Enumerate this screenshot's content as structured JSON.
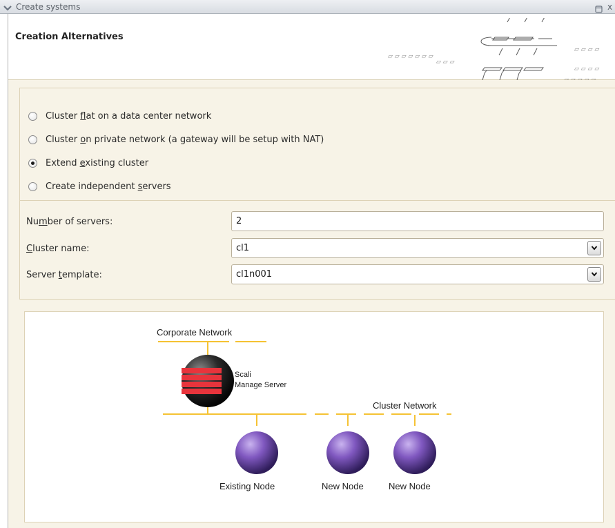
{
  "window": {
    "title": "Create systems",
    "close_glyph": "x"
  },
  "header": {
    "heading": "Creation Alternatives"
  },
  "alternatives": [
    {
      "pre": "Cluster ",
      "mn": "f",
      "post": "lat on a data center network",
      "checked": false
    },
    {
      "pre": "Cluster ",
      "mn": "o",
      "post": "n private network (a gateway will be setup with NAT)",
      "checked": false
    },
    {
      "pre": "Extend ",
      "mn": "e",
      "post": "xisting cluster",
      "checked": true
    },
    {
      "pre": "Create independent ",
      "mn": "s",
      "post": "ervers",
      "checked": false
    }
  ],
  "form": {
    "servers": {
      "pre": "Nu",
      "mn": "m",
      "post": "ber of servers:",
      "value": "2"
    },
    "cluster": {
      "pre": "",
      "mn": "C",
      "post": "luster name:",
      "value": "cl1"
    },
    "template": {
      "pre": "Server ",
      "mn": "t",
      "post": "emplate:",
      "value": "cl1n001"
    }
  },
  "diagram": {
    "corporate_network": "Corporate Network",
    "server_name": "Scali",
    "server_role": "Manage Server",
    "cluster_network": "Cluster Network",
    "nodes": [
      "Existing Node",
      "New Node",
      "New Node"
    ]
  },
  "colors": {
    "network_line": "#f5c233",
    "node_purple": "#7a54b8",
    "server_red": "#e8343c",
    "panel_bg": "#f7f3e7"
  },
  "icons": {
    "collapse": "chevron-down-icon",
    "maximize": "maximize-icon",
    "close": "close-icon",
    "combo": "chevron-down-icon"
  }
}
